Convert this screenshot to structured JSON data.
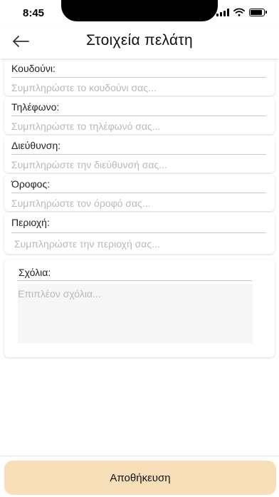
{
  "status_bar": {
    "time": "8:45"
  },
  "header": {
    "title": "Στοιχεία πελάτη"
  },
  "fields": [
    {
      "label": "Κουδούνι:",
      "placeholder": "Συμπληρώστε το κουδούνι σας..."
    },
    {
      "label": "Τηλέφωνο:",
      "placeholder": "Συμπληρώστε το τηλέφωνό σας..."
    },
    {
      "label": "Διεύθυνση:",
      "placeholder": "Συμπληρώστε την διεύθυνσή σας..."
    },
    {
      "label": "Όροφος:",
      "placeholder": "Συμπληρώστε τον όροφό σας..."
    },
    {
      "label": "Περιοχή:",
      "placeholder": "Συμπληρώστε την περιοχή σας..."
    }
  ],
  "comments": {
    "label": "Σχόλια:",
    "placeholder": "Επιπλέον σχόλια..."
  },
  "actions": {
    "save_label": "Αποθήκευση"
  },
  "colors": {
    "save_button_bg": "#f6dfb8",
    "comments_bg": "#f6f6f6"
  }
}
